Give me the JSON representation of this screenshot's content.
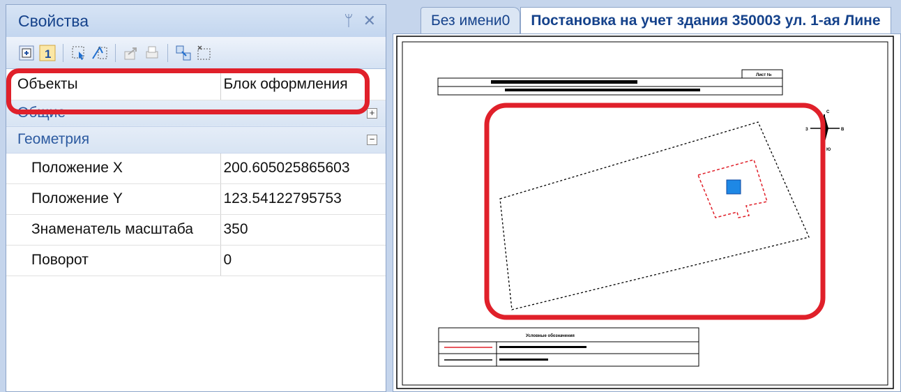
{
  "panel": {
    "title": "Свойства",
    "pin_glyph": "ᛘ",
    "close_glyph": "✕",
    "toolbar_icons": [
      "expand-all-icon",
      "sort-number-icon",
      "select-object-icon",
      "select-multiple-icon",
      "export-icon",
      "print-icon",
      "filter-icon",
      "deselect-icon"
    ]
  },
  "grid": {
    "objects": {
      "label": "Объекты",
      "value": "Блок оформления"
    },
    "categories": [
      {
        "label": "Общие",
        "state": "+"
      },
      {
        "label": "Геометрия",
        "state": "−"
      }
    ],
    "rows": [
      {
        "label": "Положение X",
        "value": "200.605025865603"
      },
      {
        "label": "Положение Y",
        "value": "123.54122795753"
      },
      {
        "label": "Знаменатель масштаба",
        "value": "350"
      },
      {
        "label": "Поворот",
        "value": "0"
      }
    ]
  },
  "tabs": [
    {
      "label": "Без имени0",
      "active": false
    },
    {
      "label": "Постановка на учет здания 350003 ул. 1-ая Лине",
      "active": true
    }
  ],
  "drawing": {
    "sheet_label": "Лист №",
    "north_marks": [
      "С",
      "З",
      "В",
      "Ю"
    ],
    "legend_title": "Условные обозначения"
  },
  "colors": {
    "highlight": "#e0202a",
    "building": "#e0202a",
    "marker": "#1e88e5"
  }
}
